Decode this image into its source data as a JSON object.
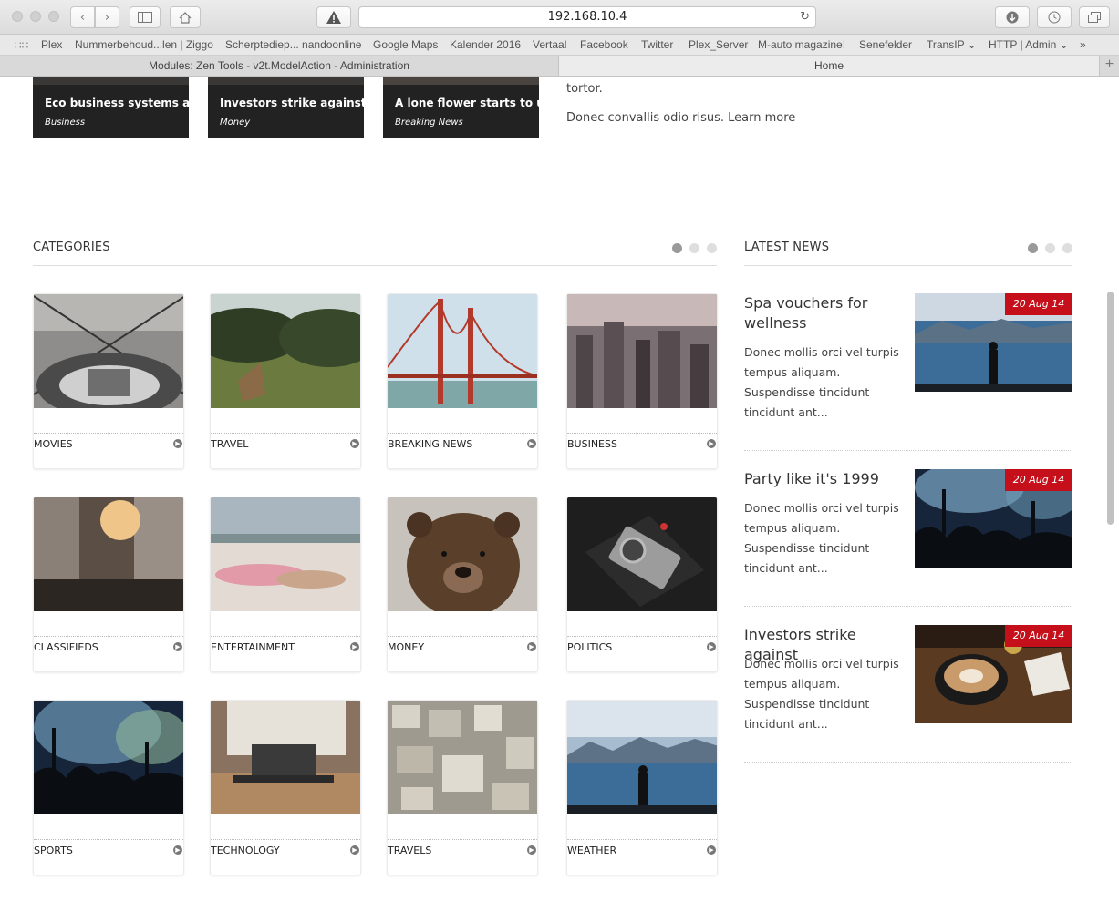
{
  "browser": {
    "url": "192.168.10.4",
    "bookmarks": [
      "Plex",
      "Nummerbehoud...len | Ziggo",
      "Scherptediep... nandoonline",
      "Google Maps",
      "Kalender 2016",
      "Vertaal",
      "Facebook",
      "Twitter",
      "Plex_Server",
      "M-auto magazine!",
      "Senefelder",
      "TransIP ⌄",
      "HTTP | Admin ⌄"
    ],
    "bookmarks_more": "»",
    "tabs": [
      "Modules: Zen Tools - v2t.ModelAction - Administration",
      "Home"
    ],
    "new_tab": "+"
  },
  "featured": [
    {
      "title": "Eco business systems and",
      "category": "Business"
    },
    {
      "title": "Investors strike against",
      "category": "Money"
    },
    {
      "title": "A lone flower starts to u",
      "category": "Breaking News"
    }
  ],
  "intro": {
    "line1": "tortor.",
    "line2": "Donec convallis odio risus. Learn more"
  },
  "categories": {
    "title": "CATEGORIES",
    "items": [
      "MOVIES",
      "TRAVEL",
      "BREAKING NEWS",
      "BUSINESS",
      "CLASSIFIEDS",
      "ENTERTAINMENT",
      "MONEY",
      "POLITICS",
      "SPORTS",
      "TECHNOLOGY",
      "TRAVELS",
      "WEATHER"
    ]
  },
  "latest": {
    "title": "LATEST NEWS",
    "items": [
      {
        "title": "Spa vouchers for wellness",
        "body": "Donec mollis orci vel turpis tempus aliquam. Suspendisse tincidunt tincidunt ant...",
        "date": "20 Aug 14"
      },
      {
        "title": "Party like it's 1999",
        "body": "Donec mollis orci vel turpis tempus aliquam. Suspendisse tincidunt tincidunt ant...",
        "date": "20 Aug 14"
      },
      {
        "title": "Investors strike against",
        "body": "Donec mollis orci vel turpis tempus aliquam. Suspendisse tincidunt tincidunt ant...",
        "date": "20 Aug 14"
      }
    ]
  },
  "colors": {
    "date_badge": "#c5101b",
    "dot_active": "#9a9a9a",
    "dot_inactive": "#dedede"
  }
}
